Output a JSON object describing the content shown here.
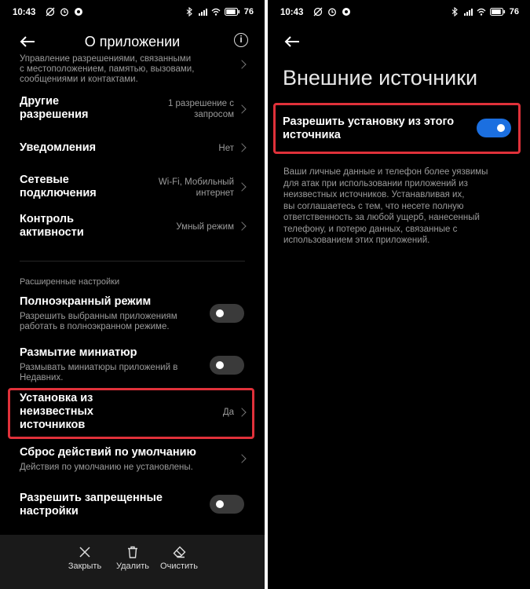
{
  "left": {
    "status": {
      "time": "10:43",
      "battery": "76"
    },
    "header": {
      "title": "О приложении"
    },
    "permissions_cut_text": "Управление разрешениями, связанными\nс местоположением, памятью, вызовами,\nсообщениями и контактами.",
    "items": [
      {
        "label": "Другие\nразрешения",
        "value": "1 разрешение с\nзапросом"
      },
      {
        "label": "Уведомления",
        "value": "Нет"
      },
      {
        "label": "Сетевые\nподключения",
        "value": "Wi-Fi, Мобильный\nинтернет"
      },
      {
        "label": "Контроль\nактивности",
        "value": "Умный режим"
      }
    ],
    "section_title": "Расширенные настройки",
    "fullscreen": {
      "label": "Полноэкранный режим",
      "desc": "Разрешить выбранным приложениям\nработать в полноэкранном режиме.",
      "on": false
    },
    "blur": {
      "label": "Размытие миниатюр",
      "desc": "Размывать миниатюры приложений в\nНедавних.",
      "on": false
    },
    "unknown_sources": {
      "label": "Установка из\nнеизвестных\nисточников",
      "value": "Да"
    },
    "reset": {
      "label": "Сброс действий по умолчанию",
      "desc": "Действия по умолчанию не установлены."
    },
    "restricted": {
      "label": "Разрешить запрещенные\nнастройки",
      "on": false
    },
    "bottom": {
      "close": "Закрыть",
      "delete": "Удалить",
      "clear": "Очистить"
    }
  },
  "right": {
    "status": {
      "time": "10:43",
      "battery": "76"
    },
    "title": "Внешние источники",
    "toggle": {
      "label": "Разрешить установку из этого\nисточника",
      "on": true
    },
    "description": "Ваши личные данные и телефон более уязвимы\nдля атак при использовании приложений из\nнеизвестных источников. Устанавливая их,\nвы соглашаетесь с тем, что несете полную\nответственность за любой ущерб, нанесенный\nтелефону, и потерю данных, связанные с\nиспользованием этих приложений."
  },
  "colors": {
    "highlight": "#e0313a",
    "toggle_on": "#1b6fe0",
    "background": "#000000"
  }
}
